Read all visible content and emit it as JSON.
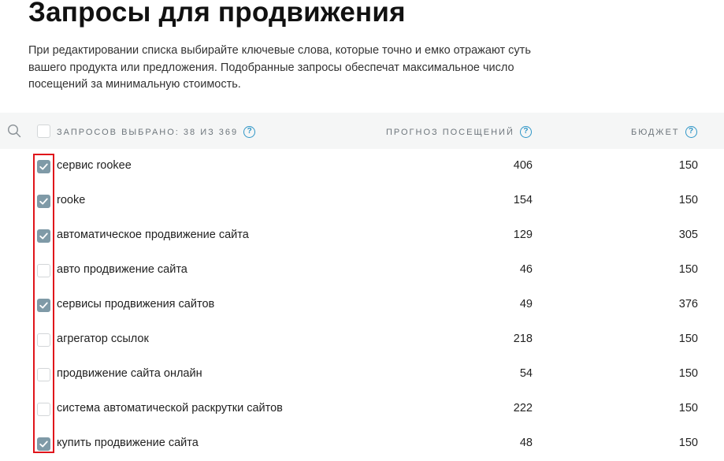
{
  "page": {
    "title": "Запросы для продвижения",
    "description": "При редактировании списка выбирайте ключевые слова, которые точно и емко отражают суть вашего продукта или предложения. Подобранные запросы обеспечат максимальное число посещений за минимальную стоимость."
  },
  "table": {
    "header": {
      "selected_label": "Запросов выбрано: 38 из 369",
      "forecast_label": "Прогноз посещений",
      "budget_label": "Бюджет",
      "help_glyph": "?"
    },
    "rows": [
      {
        "query": "сервис rookee",
        "forecast": "406",
        "budget": "150",
        "checked": true
      },
      {
        "query": "rooke",
        "forecast": "154",
        "budget": "150",
        "checked": true
      },
      {
        "query": "автоматическое продвижение сайта",
        "forecast": "129",
        "budget": "305",
        "checked": true
      },
      {
        "query": "авто продвижение сайта",
        "forecast": "46",
        "budget": "150",
        "checked": false
      },
      {
        "query": "сервисы продвижения сайтов",
        "forecast": "49",
        "budget": "376",
        "checked": true
      },
      {
        "query": "агрегатор ссылок",
        "forecast": "218",
        "budget": "150",
        "checked": false
      },
      {
        "query": "продвижение сайта онлайн",
        "forecast": "54",
        "budget": "150",
        "checked": false
      },
      {
        "query": "система автоматической раскрутки сайтов",
        "forecast": "222",
        "budget": "150",
        "checked": false
      },
      {
        "query": "купить продвижение сайта",
        "forecast": "48",
        "budget": "150",
        "checked": true
      }
    ]
  },
  "colors": {
    "checkbox_checked": "#7f9aa7",
    "highlight": "#e0151b",
    "help_icon": "#2f96c7"
  }
}
